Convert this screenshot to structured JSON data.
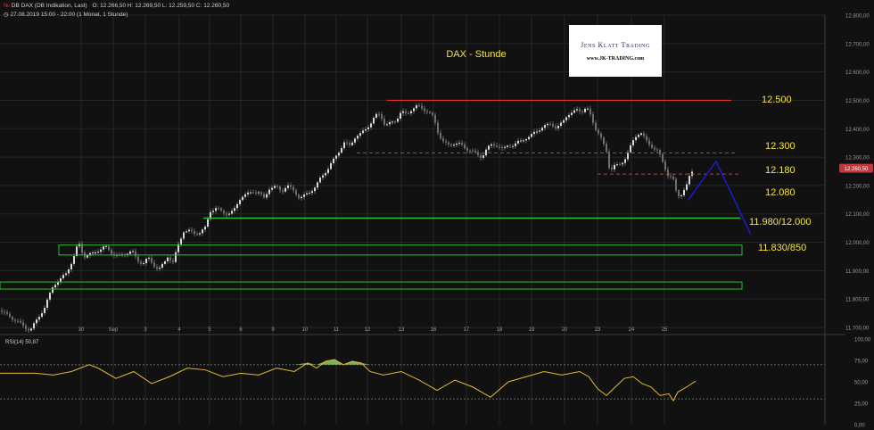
{
  "header": {
    "instrument": "DB DAX (DB Indikation, Last)",
    "ohlc": "O: 12.266,50   H: 12.269,50   L: 12.259,50   C: 12.260,50",
    "range": "27.08.2019 15:00 - 22:00   (1 Monat, 1 Stunde)"
  },
  "logo": {
    "name": "Jens Klatt Trading",
    "url": "www.JK-TRADING.com"
  },
  "colors": {
    "background": "#111111",
    "grid": "#262626",
    "candle_up": "#d9d9d9",
    "candle_down": "#6f6f6f",
    "resistance": "#e0302a",
    "support": "#2fbf2f",
    "projection": "#1c1cd8",
    "label": "#f5e63c",
    "rsi_line": "#e8b830",
    "price_badge": "#c4373a"
  },
  "chart_data": [
    {
      "type": "candlestick",
      "title": "DAX - Stunde",
      "x_tick_labels": [
        "30",
        "Sep",
        "3",
        "4",
        "5",
        "6",
        "9",
        "10",
        "11",
        "12",
        "13",
        "16",
        "17",
        "18",
        "19",
        "20",
        "23",
        "24",
        "25"
      ],
      "ylim": [
        11700,
        12800
      ],
      "y_ticks": [
        11700,
        11800,
        11900,
        12000,
        12100,
        12200,
        12300,
        12400,
        12500,
        12600,
        12700,
        12800
      ],
      "y_tick_labels": [
        "11.700,00",
        "11.800,00",
        "11.900,00",
        "12.000,00",
        "12.100,00",
        "12.200,00",
        "12.300,00",
        "12.400,00",
        "12.500,00",
        "12.600,00",
        "12.700,00",
        "12.800,00"
      ],
      "last_price": 12260.5,
      "last_price_label": "12.260,50",
      "path_x": [
        0,
        10,
        20,
        28,
        34,
        40,
        50,
        60,
        68,
        74,
        82,
        88,
        94,
        104,
        112,
        118,
        126,
        134,
        140,
        148,
        154,
        160,
        166,
        172,
        178,
        184,
        188,
        194,
        200,
        206,
        212,
        218,
        224,
        230,
        236,
        242,
        250,
        256,
        262,
        270,
        278,
        284,
        290,
        296,
        302,
        310,
        316,
        322,
        330,
        336,
        342,
        348,
        354,
        360,
        368,
        374,
        380,
        386,
        392,
        398,
        404,
        410,
        416,
        420,
        424,
        428,
        432,
        438,
        444,
        450,
        456,
        462,
        468,
        474,
        480,
        486,
        492,
        498,
        504,
        510,
        516,
        522,
        528,
        534,
        540,
        546,
        552,
        558,
        564,
        570,
        576,
        582,
        588,
        594,
        600,
        606,
        612,
        618,
        624,
        630,
        636,
        642,
        648,
        652,
        656,
        660,
        664,
        668,
        672,
        676,
        680,
        684,
        688,
        694,
        700,
        706,
        712,
        718,
        722,
        726,
        730,
        734,
        738,
        742,
        746,
        750,
        754,
        758,
        762,
        766,
        770,
        774,
        778
      ],
      "path_y": [
        11760,
        11740,
        11720,
        11700,
        11690,
        11720,
        11770,
        11850,
        11870,
        11890,
        11940,
        12000,
        11950,
        11960,
        11975,
        11985,
        11960,
        11950,
        11960,
        11970,
        11935,
        11925,
        11945,
        11920,
        11905,
        11925,
        11950,
        11930,
        11990,
        12040,
        12040,
        12030,
        12035,
        12050,
        12110,
        12120,
        12105,
        12100,
        12110,
        12160,
        12170,
        12180,
        12175,
        12155,
        12190,
        12195,
        12180,
        12200,
        12180,
        12155,
        12165,
        12180,
        12195,
        12230,
        12260,
        12290,
        12320,
        12350,
        12340,
        12370,
        12380,
        12400,
        12420,
        12440,
        12455,
        12440,
        12410,
        12420,
        12430,
        12460,
        12450,
        12470,
        12480,
        12470,
        12460,
        12440,
        12380,
        12350,
        12340,
        12350,
        12345,
        12330,
        12325,
        12310,
        12300,
        12330,
        12345,
        12340,
        12325,
        12345,
        12340,
        12355,
        12365,
        12370,
        12390,
        12400,
        12410,
        12420,
        12400,
        12420,
        12450,
        12455,
        12470,
        12460,
        12470,
        12465,
        12430,
        12400,
        12380,
        12350,
        12320,
        12250,
        12270,
        12270,
        12290,
        12330,
        12370,
        12390,
        12370,
        12350,
        12340,
        12330,
        12320,
        12290,
        12260,
        12230,
        12230,
        12180,
        12160,
        12180,
        12200,
        12240,
        12260
      ]
    },
    {
      "type": "line",
      "title": "RSI(14)",
      "series_label": "RSI(14)  50,87",
      "ylim": [
        0,
        100
      ],
      "y_tick_labels": [
        "100,00",
        "75,00",
        "50,00",
        "25,00",
        "0,00"
      ],
      "bands": [
        70,
        30
      ],
      "path_x": [
        0,
        40,
        60,
        80,
        100,
        110,
        130,
        150,
        170,
        190,
        210,
        230,
        250,
        270,
        290,
        310,
        330,
        345,
        355,
        365,
        375,
        385,
        395,
        405,
        415,
        430,
        450,
        470,
        490,
        510,
        530,
        550,
        570,
        590,
        610,
        630,
        650,
        660,
        670,
        680,
        690,
        700,
        710,
        720,
        730,
        740,
        750,
        755,
        760,
        770,
        780
      ],
      "values": [
        60,
        60,
        58,
        62,
        70,
        66,
        54,
        62,
        48,
        56,
        66,
        64,
        56,
        60,
        58,
        66,
        62,
        72,
        66,
        74,
        76,
        70,
        74,
        72,
        62,
        58,
        62,
        52,
        40,
        52,
        44,
        32,
        50,
        56,
        62,
        58,
        62,
        56,
        42,
        34,
        44,
        54,
        56,
        48,
        44,
        34,
        36,
        28,
        38,
        44,
        51
      ]
    }
  ],
  "levels": [
    {
      "label": "12.500",
      "value": 12500,
      "style": "resistance"
    },
    {
      "label": "12.300",
      "value": 12315,
      "style": "dashed"
    },
    {
      "label": "12.180",
      "value": 12240,
      "style": "dashed"
    },
    {
      "label": "12.080",
      "value": 12085,
      "style": "support"
    },
    {
      "label": "11.980/12.000",
      "from": 11955,
      "to": 11990,
      "style": "zone"
    },
    {
      "label": "11.830/850",
      "from": 11835,
      "to": 11860,
      "style": "zone"
    }
  ],
  "projection": {
    "values": [
      12150,
      12285,
      12070
    ]
  }
}
